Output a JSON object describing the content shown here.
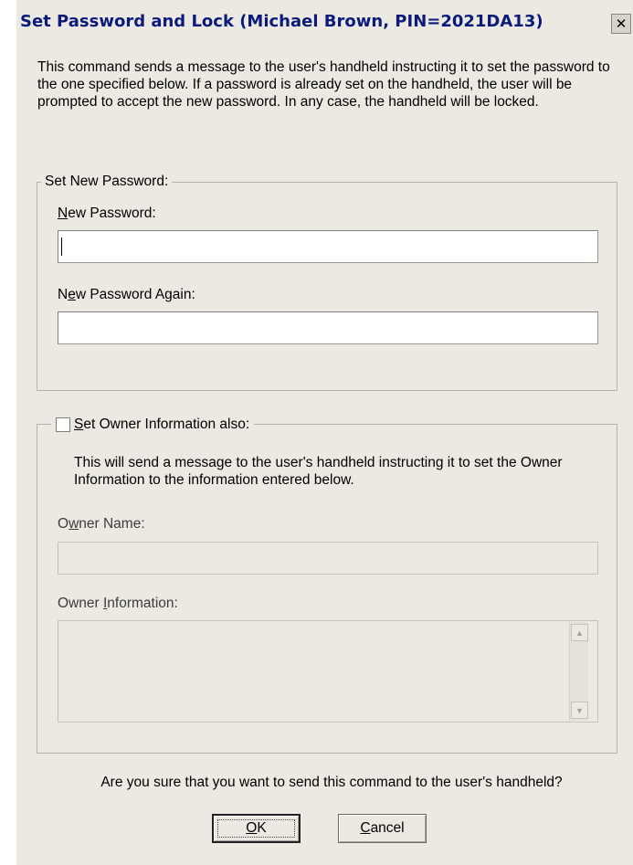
{
  "dialog": {
    "title": "Set Password and Lock (Michael Brown, PIN=2021DA13)",
    "close_glyph": "✕",
    "description": "This command sends a message to the user's handheld instructing it to set the password to the one specified below. If a password is already set on the handheld, the user will be prompted to accept the new password. In any case, the handheld will be locked."
  },
  "password_group": {
    "legend": "Set New Password:",
    "new_password_label_ul": "N",
    "new_password_label_rest": "ew Password:",
    "new_password_value": "",
    "again_label_pre": "N",
    "again_label_ul": "e",
    "again_label_rest": "w Password Again:",
    "again_value": ""
  },
  "owner_group": {
    "checkbox_label_ul": "S",
    "checkbox_label_rest": "et Owner Information also:",
    "checked": false,
    "description": "This will send a message to the user's handheld instructing it to set the Owner Information to the information entered below.",
    "owner_name_label_pre": "O",
    "owner_name_label_ul": "w",
    "owner_name_label_rest": "ner Name:",
    "owner_name_value": "",
    "owner_info_label_pre": "Owner ",
    "owner_info_label_ul": "I",
    "owner_info_label_rest": "nformation:",
    "owner_info_value": "",
    "scroll_up_glyph": "▲",
    "scroll_down_glyph": "▼"
  },
  "confirm_text": "Are you sure that you want to send this command to the user's handheld?",
  "buttons": {
    "ok_ul": "O",
    "ok_rest": "K",
    "cancel_ul": "C",
    "cancel_rest": "ancel"
  }
}
